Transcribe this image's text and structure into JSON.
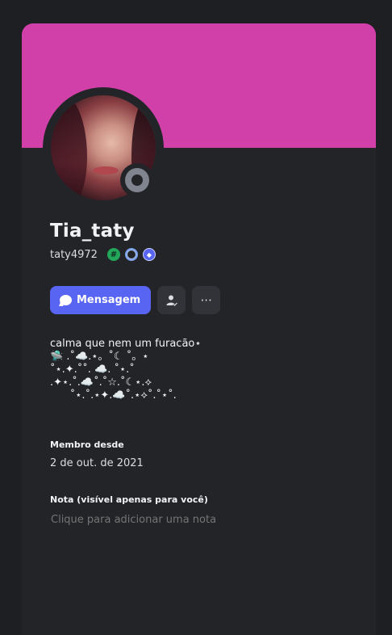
{
  "profile": {
    "display_name": "Tia_taty",
    "username": "taty4972",
    "banner_color": "#d13fa8",
    "avatar_icon": "avatar-photo",
    "status": "offline",
    "status_color": "#80848e",
    "badges": [
      "hash-badge",
      "nitro-boost-badge",
      "quest-badge"
    ]
  },
  "actions": {
    "message_label": "Mensagem",
    "message_icon": "chat-bubble-icon",
    "friend_icon": "add-friend-icon",
    "more_label": "···",
    "accent_color": "#5865f2"
  },
  "bio": {
    "lines": [
      "calma que nem um furacão⋆",
      "🛸 .˚☁️.⋆。˚☾ ˚。⋆",
      "˚⋆.✦.˚˚. ☁️. ˚⋆.˚",
      ".✦⋆.˚.☁️˚.˚☆.˚☾⋆.⟡",
      "      ˚⋆.˚.⋆✦.☁️˚.⋆⟡˚.˚⋆˚."
    ]
  },
  "member_since": {
    "title": "Membro desde",
    "value": "2 de out. de 2021"
  },
  "note": {
    "title": "Nota (visível apenas para você)",
    "placeholder": "Clique para adicionar uma nota"
  }
}
